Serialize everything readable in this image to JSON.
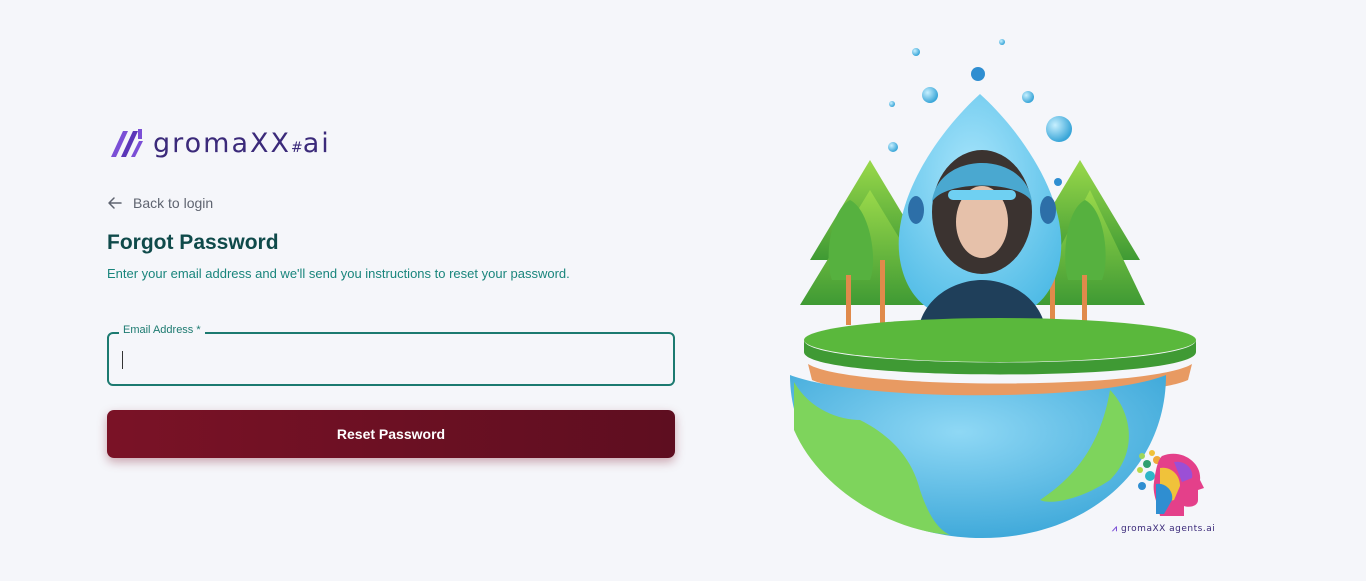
{
  "brand": {
    "name": "gromaXX",
    "suffix": "ai",
    "hash": "#"
  },
  "back_link": {
    "label": "Back to login",
    "icon": "arrow-left-icon"
  },
  "form": {
    "title": "Forgot Password",
    "subtitle": "Enter your email address and we'll send you instructions to reset your password.",
    "email": {
      "label": "Email Address *",
      "value": "",
      "placeholder": ""
    },
    "submit_label": "Reset Password"
  },
  "footer_brand": {
    "text": "gromaXX agents.ai"
  },
  "colors": {
    "brand_purple": "#3b2a7a",
    "accent_teal": "#1c7a70",
    "button_maroon": "#7a1226",
    "background": "#f5f6fa"
  }
}
